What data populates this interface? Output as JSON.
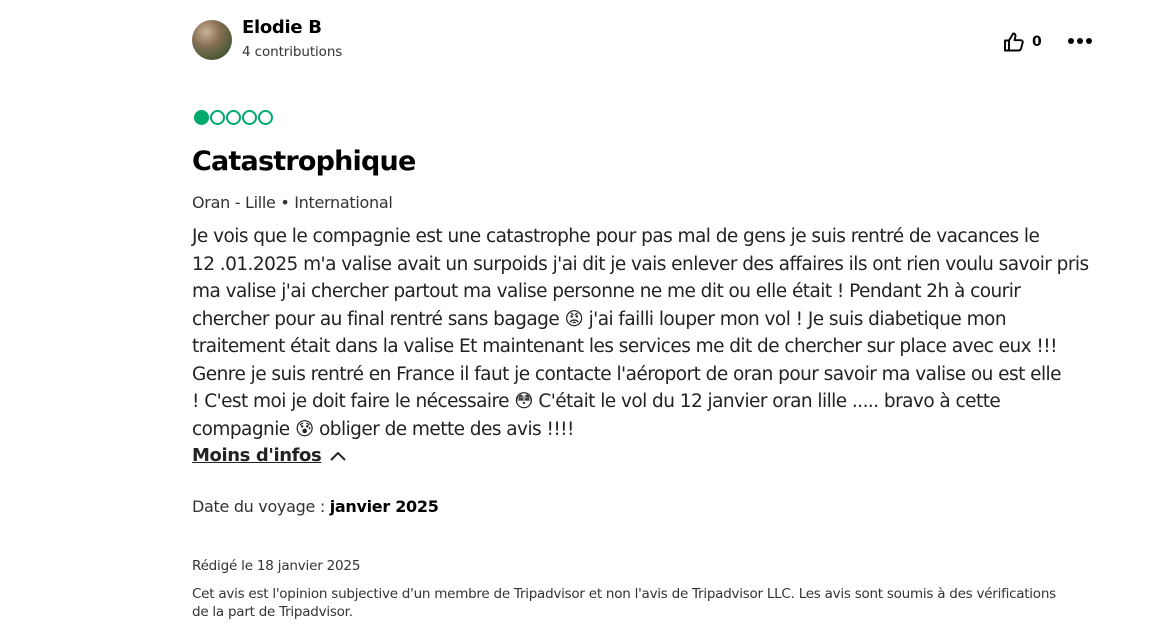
{
  "user": {
    "name": "Elodie B",
    "contributions": "4 contributions"
  },
  "helpful": {
    "count": "0"
  },
  "rating": {
    "value": 1,
    "max": 5,
    "color": "#00aa6c"
  },
  "review": {
    "title": "Catastrophique",
    "route": "Oran - Lille • International",
    "body_lines": [
      "Je vois que le compagnie est une catastrophe pour pas mal de gens je suis rentré de vacances le",
      "12 .01.2025 m'a valise avait un surpoids j'ai dit je vais enlever des affaires ils ont rien voulu savoir pris",
      "ma valise j'ai chercher partout ma valise personne ne me dit ou elle était ! Pendant 2h à courir",
      "chercher pour au final rentré sans bagage 😡 j'ai failli louper mon vol ! Je suis diabetique mon",
      "traitement était dans la valise Et maintenant les services me dit de chercher sur place avec eux !!!",
      "Genre je suis rentré en France il faut je contacte l'aéroport de oran pour savoir ma valise ou est elle",
      "! C'est moi je doit faire le nécessaire 😳 C'était le vol du 12 janvier oran lille ..... bravo à cette",
      "compagnie 😰 obliger de mette des avis !!!!"
    ],
    "less_label": "Moins d'infos",
    "trip_date_label": "Date du voyage : ",
    "trip_date_value": "janvier 2025",
    "written": "Rédigé le 18 janvier 2025",
    "disclaimer_lines": [
      "Cet avis est l'opinion subjective d'un membre de Tripadvisor et non l'avis de Tripadvisor LLC. Les avis sont soumis à des vérifications",
      "de la part de Tripadvisor."
    ]
  },
  "icons": {
    "helpful": "thumbs-up-icon",
    "more": "more-options-icon",
    "less": "chevron-up-icon"
  }
}
